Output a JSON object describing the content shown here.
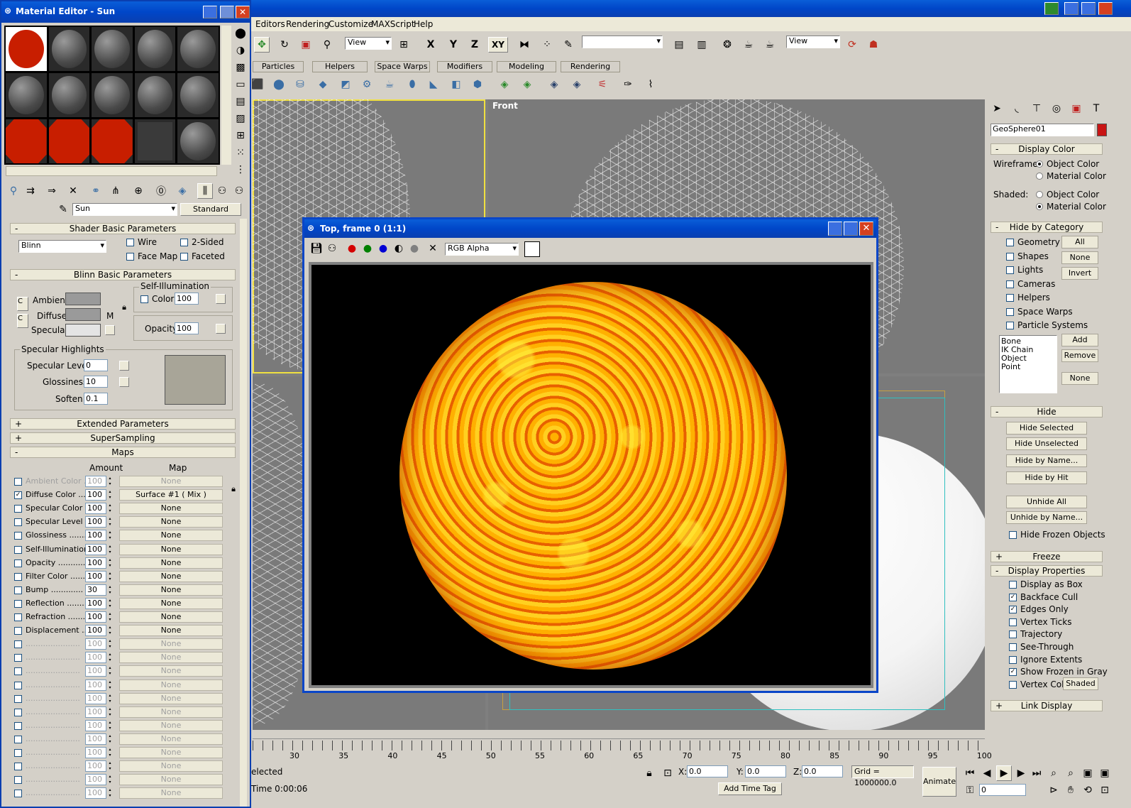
{
  "main_menu": [
    "Editors",
    "Rendering",
    "Customize",
    "MAXScript",
    "Help"
  ],
  "toolbar": {
    "view_dropdown": "View",
    "axis_labels": [
      "X",
      "Y",
      "Z",
      "XY"
    ],
    "named_sel": "",
    "view2": "View"
  },
  "create_tabs": [
    "Particles",
    "Helpers",
    "Space Warps",
    "Modifiers",
    "Modeling",
    "Rendering"
  ],
  "viewport_front_label": "Front",
  "material_editor": {
    "title": "Material Editor - Sun",
    "material_name": "Sun",
    "material_type": "Standard",
    "rollouts": {
      "shader_basic": "Shader Basic Parameters",
      "blinn_basic": "Blinn Basic Parameters",
      "extended": "Extended Parameters",
      "supersampling": "SuperSampling",
      "maps": "Maps"
    },
    "shader": "Blinn",
    "wire": "Wire",
    "two_sided": "2-Sided",
    "face_map": "Face Map",
    "faceted": "Faceted",
    "ambient": "Ambient:",
    "diffuse": "Diffuse:",
    "specular": "Specular:",
    "self_illum_group": "Self-Illumination",
    "color_label": "Color",
    "color_value": "100",
    "opacity_label": "Opacity:",
    "opacity_value": "100",
    "m_label": "M",
    "spec_highlights": "Specular Highlights",
    "spec_level_label": "Specular Level:",
    "spec_level": "0",
    "glossiness_label": "Glossiness:",
    "glossiness": "10",
    "soften_label": "Soften:",
    "soften": "0.1",
    "maps_amount_hdr": "Amount",
    "maps_map_hdr": "Map",
    "maps": [
      {
        "name": "Ambient Color ..",
        "amount": "100",
        "map": "None",
        "checked": false,
        "dim": true
      },
      {
        "name": "Diffuse Color ....",
        "amount": "100",
        "map": "Surface #1  ( Mix )",
        "checked": true,
        "dim": false
      },
      {
        "name": "Specular Color ..",
        "amount": "100",
        "map": "None",
        "checked": false,
        "dim": false
      },
      {
        "name": "Specular Level ..",
        "amount": "100",
        "map": "None",
        "checked": false,
        "dim": false
      },
      {
        "name": "Glossiness .......",
        "amount": "100",
        "map": "None",
        "checked": false,
        "dim": false
      },
      {
        "name": "Self-Illumination .",
        "amount": "100",
        "map": "None",
        "checked": false,
        "dim": false
      },
      {
        "name": "Opacity ...........",
        "amount": "100",
        "map": "None",
        "checked": false,
        "dim": false
      },
      {
        "name": "Filter Color .......",
        "amount": "100",
        "map": "None",
        "checked": false,
        "dim": false
      },
      {
        "name": "Bump .............",
        "amount": "30",
        "map": "None",
        "checked": false,
        "dim": false
      },
      {
        "name": "Reflection ........",
        "amount": "100",
        "map": "None",
        "checked": false,
        "dim": false
      },
      {
        "name": "Refraction ........",
        "amount": "100",
        "map": "None",
        "checked": false,
        "dim": false
      },
      {
        "name": "Displacement ....",
        "amount": "100",
        "map": "None",
        "checked": false,
        "dim": false
      },
      {
        "name": "......................",
        "amount": "100",
        "map": "None",
        "checked": false,
        "dim": true
      },
      {
        "name": "......................",
        "amount": "100",
        "map": "None",
        "checked": false,
        "dim": true
      },
      {
        "name": "......................",
        "amount": "100",
        "map": "None",
        "checked": false,
        "dim": true
      },
      {
        "name": "......................",
        "amount": "100",
        "map": "None",
        "checked": false,
        "dim": true
      },
      {
        "name": "......................",
        "amount": "100",
        "map": "None",
        "checked": false,
        "dim": true
      },
      {
        "name": "......................",
        "amount": "100",
        "map": "None",
        "checked": false,
        "dim": true
      },
      {
        "name": "......................",
        "amount": "100",
        "map": "None",
        "checked": false,
        "dim": true
      },
      {
        "name": "......................",
        "amount": "100",
        "map": "None",
        "checked": false,
        "dim": true
      },
      {
        "name": "......................",
        "amount": "100",
        "map": "None",
        "checked": false,
        "dim": true
      },
      {
        "name": "......................",
        "amount": "100",
        "map": "None",
        "checked": false,
        "dim": true
      },
      {
        "name": "......................",
        "amount": "100",
        "map": "None",
        "checked": false,
        "dim": true
      },
      {
        "name": "......................",
        "amount": "100",
        "map": "None",
        "checked": false,
        "dim": true
      }
    ],
    "slots": [
      "red",
      "gray",
      "gray",
      "gray",
      "gray",
      "gray",
      "gray",
      "gray",
      "gray",
      "gray",
      "redflat",
      "redflat",
      "redflat",
      "dark",
      "gray"
    ]
  },
  "render_window": {
    "title": "Top, frame 0 (1:1)",
    "channel": "RGB Alpha"
  },
  "command_panel": {
    "object_name": "GeoSphere01",
    "display_color": "Display Color",
    "wireframe_label": "Wireframe:",
    "shaded_label": "Shaded:",
    "object_color": "Object Color",
    "material_color": "Material Color",
    "hide_by_category": "Hide by Category",
    "categories": [
      "Geometry",
      "Shapes",
      "Lights",
      "Cameras",
      "Helpers",
      "Space Warps",
      "Particle Systems"
    ],
    "all_btn": "All",
    "none_btn": "None",
    "invert_btn": "Invert",
    "list_items": [
      "Bone",
      "IK Chain Object",
      "Point"
    ],
    "add_btn": "Add",
    "remove_btn": "Remove",
    "none_btn2": "None",
    "hide": "Hide",
    "hide_buttons": [
      "Hide Selected",
      "Hide Unselected",
      "Hide by Name...",
      "Hide by Hit"
    ],
    "unhide_buttons": [
      "Unhide All",
      "Unhide by Name..."
    ],
    "hide_frozen": "Hide Frozen Objects",
    "freeze": "Freeze",
    "display_properties": "Display Properties",
    "display_props": [
      {
        "label": "Display as Box",
        "checked": false
      },
      {
        "label": "Backface Cull",
        "checked": true
      },
      {
        "label": "Edges Only",
        "checked": true
      },
      {
        "label": "Vertex Ticks",
        "checked": false
      },
      {
        "label": "Trajectory",
        "checked": false
      },
      {
        "label": "See-Through",
        "checked": false
      },
      {
        "label": "Ignore Extents",
        "checked": false
      },
      {
        "label": "Show Frozen in Gray",
        "checked": true
      },
      {
        "label": "Vertex Colors",
        "checked": false
      }
    ],
    "shaded_btn": "Shaded",
    "link_display": "Link Display"
  },
  "timeline_ticks": [
    "30",
    "35",
    "40",
    "45",
    "50",
    "55",
    "60",
    "65",
    "70",
    "75",
    "80",
    "85",
    "90",
    "95",
    "100"
  ],
  "status": {
    "selected": "elected",
    "time": "Time  0:00:06",
    "x_label": "X:",
    "x": "0.0",
    "y_label": "Y:",
    "y": "0.0",
    "z_label": "Z:",
    "z": "0.0",
    "grid": "Grid = 1000000.0",
    "add_time_tag": "Add Time Tag",
    "animate": "Animate",
    "frame": "0"
  }
}
